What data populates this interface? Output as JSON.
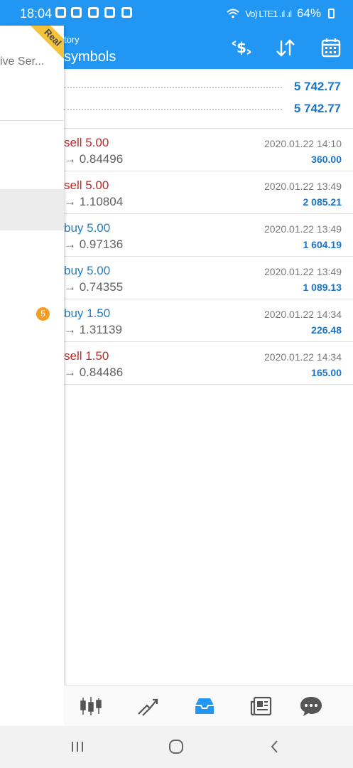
{
  "status_bar": {
    "time": "18:04",
    "battery": "64%",
    "network": "Vo) LTE1 .ıl .ıl"
  },
  "toolbar": {
    "subtitle": "tory",
    "title": "symbols",
    "icons": [
      "currency-exchange-icon",
      "sort-icon",
      "calendar-icon"
    ]
  },
  "summary": {
    "rows": [
      {
        "value": "5 742.77"
      },
      {
        "value": "5 742.77"
      }
    ]
  },
  "deals": [
    {
      "type": "sell 5.00",
      "direction": "sell",
      "price": "→ 0.84496",
      "date": "2020.01.22 14:10",
      "profit": "360.00"
    },
    {
      "type": "sell 5.00",
      "direction": "sell",
      "price": "→ 1.10804",
      "date": "2020.01.22 13:49",
      "profit": "2 085.21"
    },
    {
      "type": "buy 5.00",
      "direction": "buy",
      "price": "→ 0.97136",
      "date": "2020.01.22 13:49",
      "profit": "1 604.19"
    },
    {
      "type": "buy 5.00",
      "direction": "buy",
      "price": "→ 0.74355",
      "date": "2020.01.22 13:49",
      "profit": "1 089.13"
    },
    {
      "type": "buy 1.50",
      "direction": "buy",
      "price": "→ 1.31139",
      "date": "2020.01.22 14:34",
      "profit": "226.48"
    },
    {
      "type": "sell 1.50",
      "direction": "sell",
      "price": "→ 0.84486",
      "date": "2020.01.22 14:34",
      "profit": "165.00"
    }
  ],
  "drawer": {
    "server_text": "ive Ser...",
    "ribbon": "Real",
    "badge": "5"
  },
  "bottom_nav": {
    "items": [
      "quotes-icon",
      "charts-icon",
      "history-inbox-icon",
      "news-icon",
      "chat-icon"
    ],
    "active": "history-inbox-icon"
  },
  "colors": {
    "primary": "#2196F3",
    "sell": "#c62828",
    "buy": "#1e7fc4",
    "profit": "#1b74c5",
    "badge": "#f39c1f",
    "ribbon": "#f4c23b"
  }
}
